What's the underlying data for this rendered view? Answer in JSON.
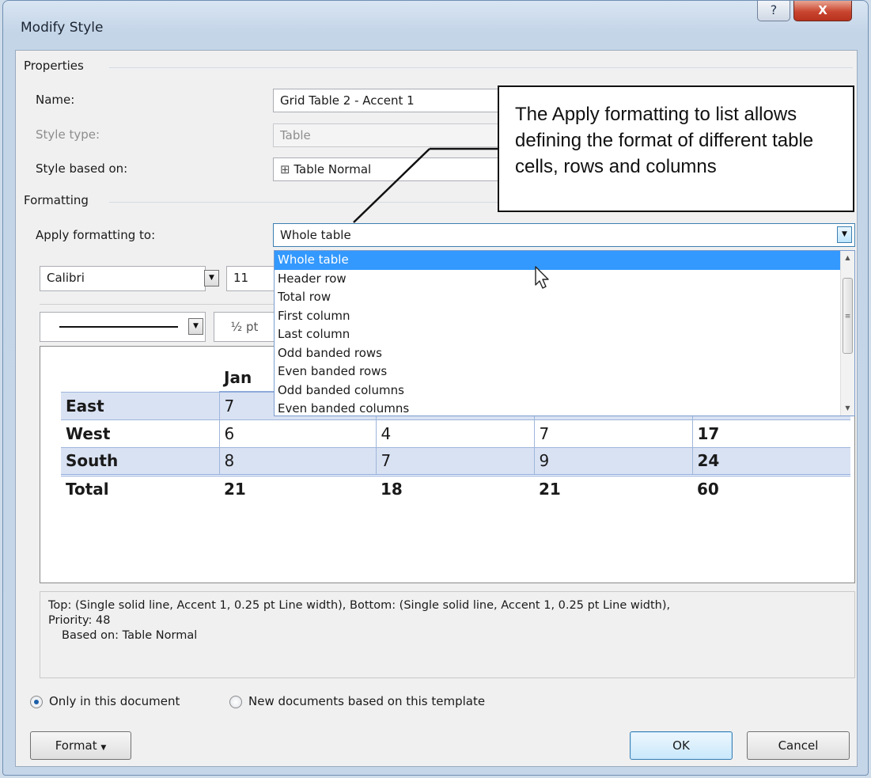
{
  "window": {
    "title": "Modify Style",
    "help": "?",
    "close": "X"
  },
  "properties": {
    "heading": "Properties",
    "name_label": "Name:",
    "name_value": "Grid Table 2 - Accent 1",
    "style_type_label": "Style type:",
    "style_type_value": "Table",
    "based_on_label": "Style based on:",
    "based_on_value": "Table Normal"
  },
  "formatting": {
    "heading": "Formatting",
    "apply_label": "Apply formatting to:",
    "apply_value": "Whole table",
    "apply_options": [
      "Whole table",
      "Header row",
      "Total row",
      "First column",
      "Last column",
      "Odd banded rows",
      "Even banded rows",
      "Odd banded columns",
      "Even banded columns"
    ],
    "font": "Calibri",
    "size": "11",
    "line_weight": "½ pt"
  },
  "preview": {
    "header": [
      "",
      "Jan",
      "",
      "",
      ""
    ],
    "rows": [
      [
        "East",
        "7",
        "",
        "",
        ""
      ],
      [
        "West",
        "6",
        "4",
        "7",
        "17"
      ],
      [
        "South",
        "8",
        "7",
        "9",
        "24"
      ]
    ],
    "total": [
      "Total",
      "21",
      "18",
      "21",
      "60"
    ]
  },
  "description": {
    "line1": "Top: (Single solid line, Accent 1,  0.25 pt Line width), Bottom: (Single solid line, Accent 1,  0.25 pt Line width),",
    "line2": "Priority: 48",
    "line3": "Based on: Table Normal"
  },
  "options": {
    "only_doc": "Only in this document",
    "new_docs": "New documents based on this template"
  },
  "buttons": {
    "format": "Format",
    "ok": "OK",
    "cancel": "Cancel"
  },
  "callout": {
    "text": "The Apply formatting to list allows defining the format of different table cells, rows and columns"
  },
  "icons": {
    "table": "table-grid-icon",
    "cursor": "mouse-pointer-icon"
  }
}
